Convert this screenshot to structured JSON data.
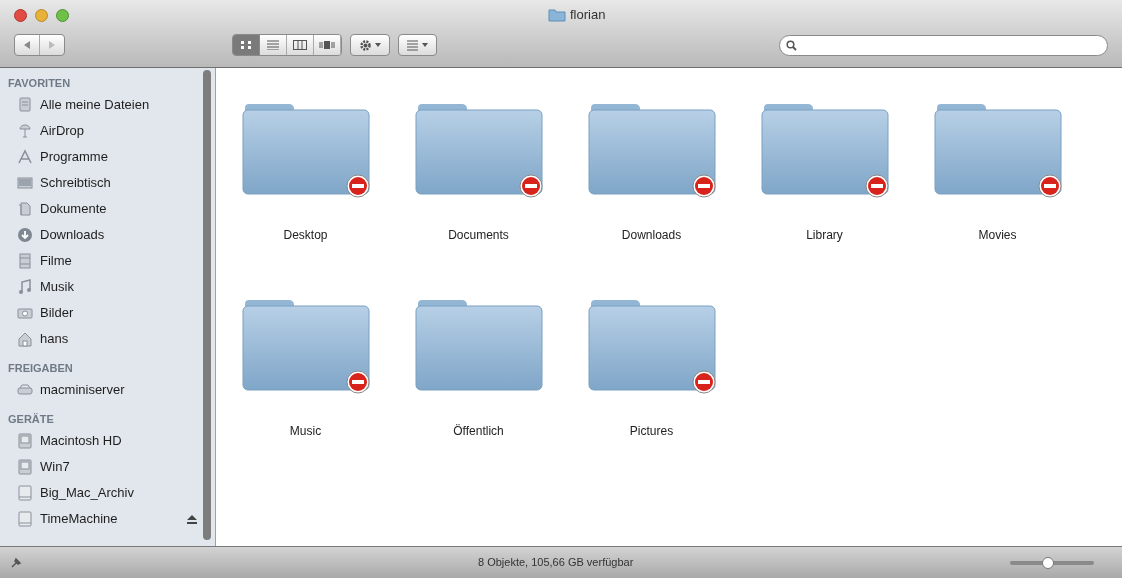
{
  "window": {
    "title": "florian"
  },
  "view_modes": [
    {
      "selected": true
    },
    {
      "selected": false
    },
    {
      "selected": false
    },
    {
      "selected": false
    }
  ],
  "sidebar": [
    {
      "heading": "FAVORITEN",
      "items": [
        {
          "label": "Alle meine Dateien"
        },
        {
          "label": "AirDrop"
        },
        {
          "label": "Programme"
        },
        {
          "label": "Schreibtisch"
        },
        {
          "label": "Dokumente"
        },
        {
          "label": "Downloads"
        },
        {
          "label": "Filme"
        },
        {
          "label": "Musik"
        },
        {
          "label": "Bilder"
        },
        {
          "label": "hans"
        }
      ]
    },
    {
      "heading": "FREIGABEN",
      "items": [
        {
          "label": "macminiserver"
        }
      ]
    },
    {
      "heading": "GERÄTE",
      "items": [
        {
          "label": "Macintosh HD",
          "ejectable": false
        },
        {
          "label": "Win7",
          "ejectable": false
        },
        {
          "label": "Big_Mac_Archiv",
          "ejectable": false
        },
        {
          "label": "TimeMachine",
          "ejectable": true
        }
      ]
    }
  ],
  "folders": [
    {
      "name": "Desktop",
      "restricted": true
    },
    {
      "name": "Documents",
      "restricted": true
    },
    {
      "name": "Downloads",
      "restricted": true
    },
    {
      "name": "Library",
      "restricted": true
    },
    {
      "name": "Movies",
      "restricted": true
    },
    {
      "name": "Music",
      "restricted": true
    },
    {
      "name": "Öffentlich",
      "restricted": false
    },
    {
      "name": "Pictures",
      "restricted": true
    }
  ],
  "status_bar": {
    "text": "8 Objekte, 105,66 GB verfügbar",
    "icon_size": {
      "level": 0.45
    }
  }
}
